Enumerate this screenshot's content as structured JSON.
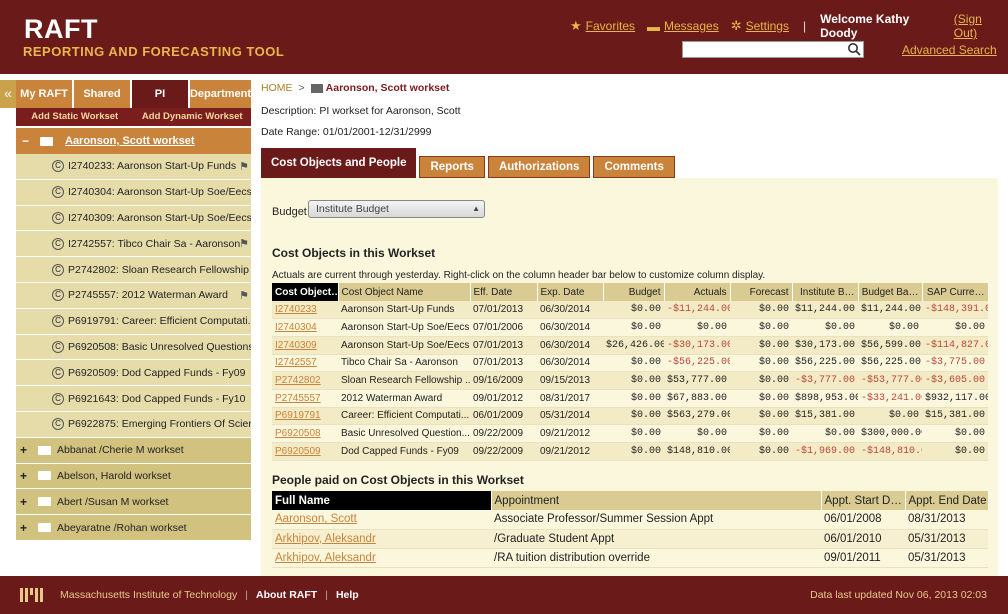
{
  "header": {
    "title": "RAFT",
    "subtitle": "REPORTING AND FORECASTING TOOL",
    "favorites": "Favorites",
    "messages": "Messages",
    "settings": "Settings",
    "welcome": "Welcome Kathy Doody",
    "signout": "(Sign Out)",
    "search_value": "",
    "advanced_search": "Advanced Search"
  },
  "left": {
    "collapse_glyph": "«",
    "tabs": [
      "My RAFT",
      "Shared",
      "PI",
      "Department"
    ],
    "active_tab": "PI",
    "add_static": "Add Static Workset",
    "add_dynamic": "Add Dynamic Workset",
    "root_item": "Aaronson, Scott workset",
    "items": [
      {
        "label": "I2740233: Aaronson Start-Up Funds",
        "flag": true
      },
      {
        "label": "I2740304: Aaronson Start-Up Soe/Eecs",
        "flag": false
      },
      {
        "label": "I2740309: Aaronson Start-Up Soe/Eecs",
        "flag": false
      },
      {
        "label": "I2742557: Tibco Chair Sa - Aaronson",
        "flag": true
      },
      {
        "label": "P2742802: Sloan Research Fellowship ...",
        "flag": false
      },
      {
        "label": "P2745557: 2012 Waterman Award",
        "flag": true
      },
      {
        "label": "P6919791: Career: Efficient Computati...",
        "flag": false
      },
      {
        "label": "P6920508: Basic Unresolved Questions-...",
        "flag": false
      },
      {
        "label": "P6920509: Dod Capped Funds - Fy09",
        "flag": false
      },
      {
        "label": "P6921643: Dod Capped Funds - Fy10",
        "flag": false
      },
      {
        "label": "P6922875: Emerging Frontiers Of Scien...",
        "flag": false
      }
    ],
    "groups": [
      "Abbanat /Cherie M workset",
      "Abelson, Harold workset",
      "Abert /Susan M workset",
      "Abeyaratne /Rohan workset"
    ]
  },
  "main": {
    "breadcrumb_home": "HOME",
    "breadcrumb_arrow": ">",
    "breadcrumb_current": "Aaronson, Scott workset",
    "description": "Description: PI workset for Aaronson, Scott",
    "date_range": "Date Range: 01/01/2001-12/31/2999",
    "tabs": [
      "Cost Objects and People",
      "Reports",
      "Authorizations",
      "Comments"
    ],
    "budget_label": "Budget",
    "budget_value": "Institute Budget",
    "cost_objects_heading": "Cost Objects in this Workset",
    "note": "Actuals are current through yesterday. Right-click on the column header bar below to customize column display.",
    "co_columns": [
      "Cost Object…",
      "Cost Object Name",
      "Eff. Date",
      "Exp. Date",
      "Budget",
      "Actuals",
      "Forecast",
      "Institute B…",
      "Budget Ba…",
      "SAP Curre…"
    ],
    "co_rows": [
      [
        "I2740233",
        "Aaronson Start-Up Funds",
        "07/01/2013",
        "06/30/2014",
        "$0.00",
        "-$11,244.00",
        "$0.00",
        "$11,244.00",
        "$11,244.00",
        "-$148,391.0"
      ],
      [
        "I2740304",
        "Aaronson Start-Up Soe/Eecs",
        "07/01/2006",
        "06/30/2014",
        "$0.00",
        "$0.00",
        "$0.00",
        "$0.00",
        "$0.00",
        "$0.00"
      ],
      [
        "I2740309",
        "Aaronson Start-Up Soe/Eecs",
        "07/01/2013",
        "06/30/2014",
        "$26,426.00",
        "-$30,173.00",
        "$0.00",
        "$30,173.00",
        "$56,599.00",
        "-$114,827.0"
      ],
      [
        "I2742557",
        "Tibco Chair Sa - Aaronson",
        "07/01/2013",
        "06/30/2014",
        "$0.00",
        "-$56,225.00",
        "$0.00",
        "$56,225.00",
        "$56,225.00",
        "-$3,775.00"
      ],
      [
        "P2742802",
        "Sloan Research Fellowship ...",
        "09/16/2009",
        "09/15/2013",
        "$0.00",
        "$53,777.00",
        "$0.00",
        "-$3,777.00",
        "-$53,777.00",
        "-$3,605.00"
      ],
      [
        "P2745557",
        "2012 Waterman Award",
        "09/01/2012",
        "08/31/2017",
        "$0.00",
        "$67,883.00",
        "$0.00",
        "$898,953.00",
        "-$33,241.00",
        "$932,117.00"
      ],
      [
        "P6919791",
        "Career: Efficient Computati...",
        "06/01/2009",
        "05/31/2014",
        "$0.00",
        "$563,279.00",
        "$0.00",
        "$15,381.00",
        "$0.00",
        "$15,381.00"
      ],
      [
        "P6920508",
        "Basic Unresolved Question...",
        "09/22/2009",
        "09/21/2012",
        "$0.00",
        "$0.00",
        "$0.00",
        "$0.00",
        "$300,000.00",
        "$0.00"
      ],
      [
        "P6920509",
        "Dod Capped Funds - Fy09",
        "09/22/2009",
        "09/21/2012",
        "$0.00",
        "$148,810.00",
        "$0.00",
        "-$1,969.00",
        "-$148,810.00",
        "$0.00"
      ]
    ],
    "people_heading": "People paid on Cost Objects in this Workset",
    "people_columns": [
      "Full Name",
      "Appointment",
      "Appt. Start D…",
      "Appt. End Date"
    ],
    "people_rows": [
      [
        "Aaronson, Scott",
        "Associate Professor/Summer Session Appt",
        "06/01/2008",
        "08/31/2013"
      ],
      [
        "Arkhipov, Aleksandr",
        "/Graduate Student Appt",
        "06/01/2010",
        "05/31/2013"
      ],
      [
        "Arkhipov, Aleksandr",
        "/RA tuition distribution override",
        "09/01/2011",
        "05/31/2013"
      ]
    ]
  },
  "footer": {
    "institution": "Massachusetts Institute of Technology",
    "separator": "|",
    "about": "About RAFT",
    "help": "Help",
    "updated": "Data last updated Nov 06, 2013 02:03"
  },
  "colors": {
    "brand": "#6b1a1a",
    "accent": "#e8b64a",
    "tab": "#c9833a",
    "negative": "#b8473a"
  }
}
